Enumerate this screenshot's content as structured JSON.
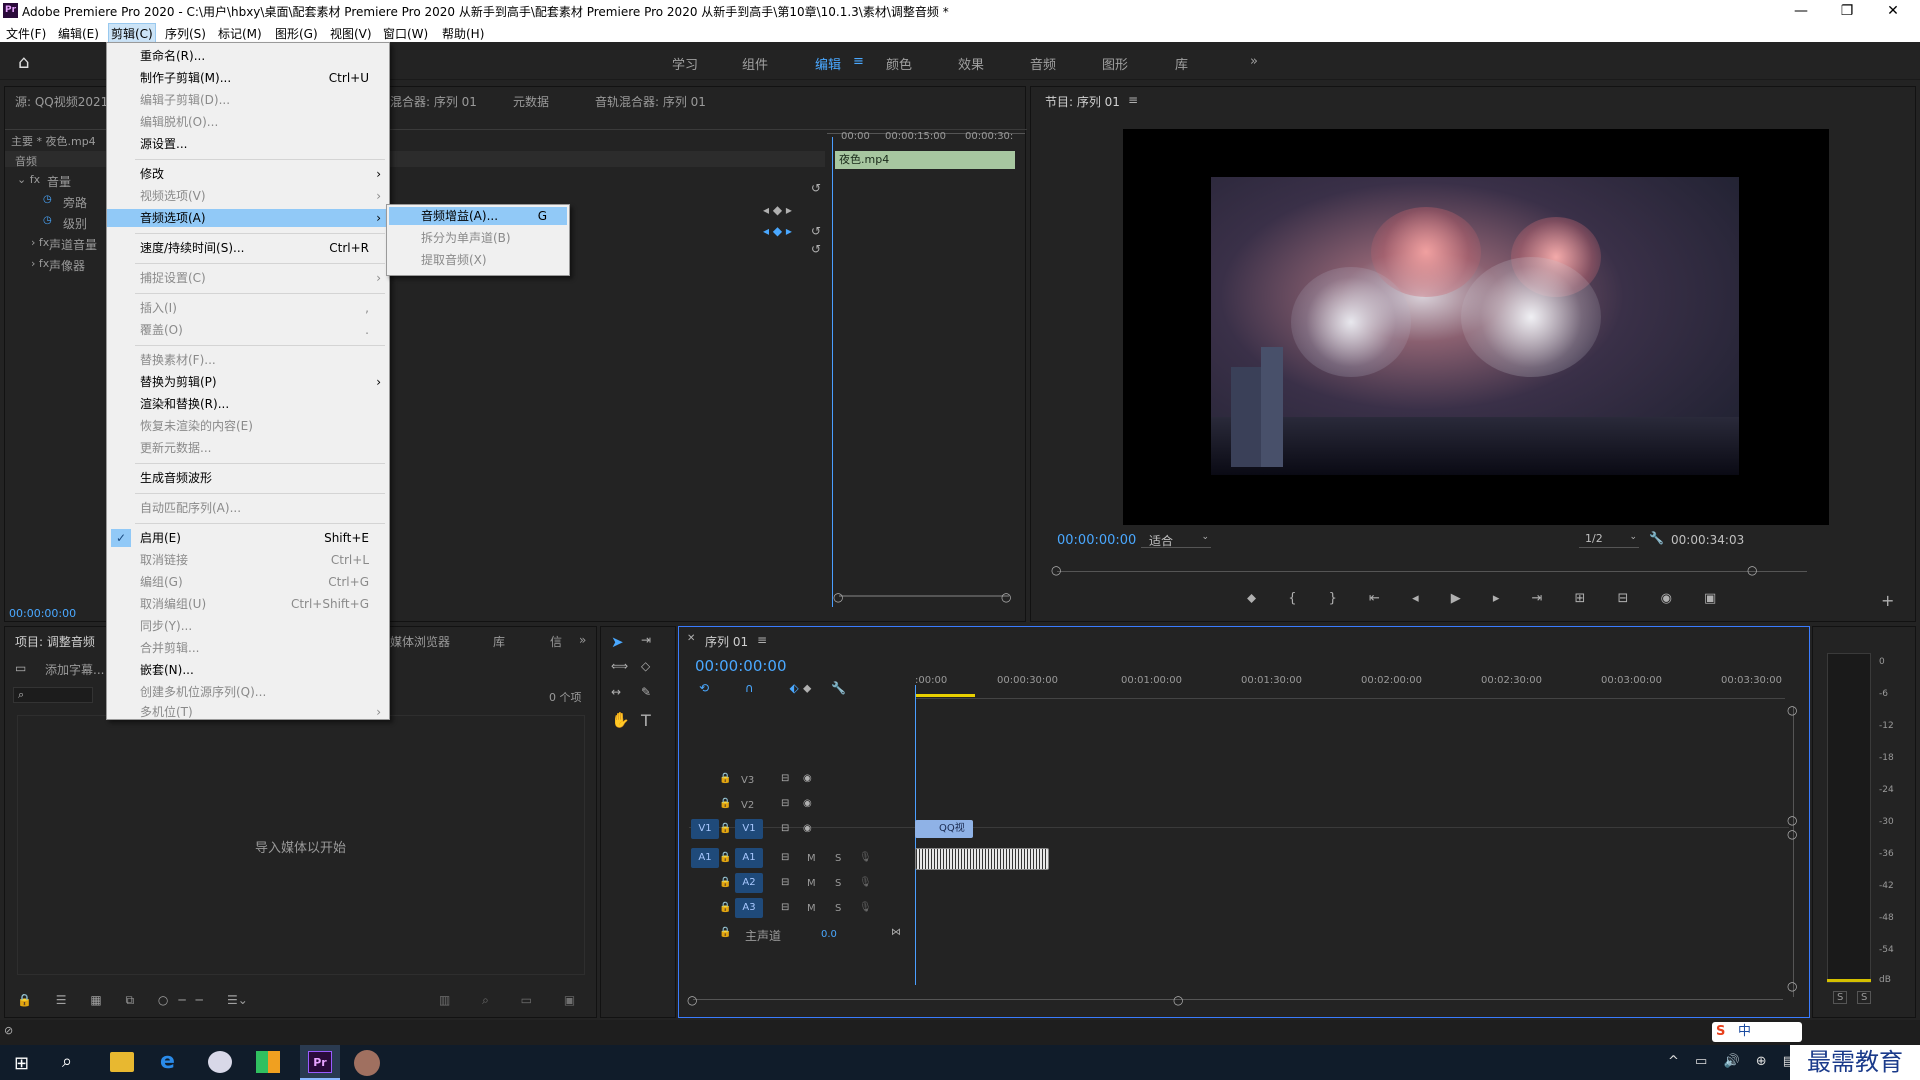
{
  "window": {
    "title": "Adobe Premiere Pro 2020 - C:\\用户\\hbxy\\桌面\\配套素材 Premiere Pro 2020 从新手到高手\\配套素材 Premiere Pro 2020 从新手到高手\\第10章\\10.1.3\\素材\\调整音频 *",
    "logo": "Pr"
  },
  "menubar": [
    "文件(F)",
    "编辑(E)",
    "剪辑(C)",
    "序列(S)",
    "标记(M)",
    "图形(G)",
    "视图(V)",
    "窗口(W)",
    "帮助(H)"
  ],
  "workspaces": [
    "学习",
    "组件",
    "编辑",
    "颜色",
    "效果",
    "音频",
    "图形",
    "库"
  ],
  "source_panel": {
    "title": "源: QQ视频2021",
    "tabs": [
      "混合器: 序列 01",
      "元数据",
      "音轨混合器: 序列 01"
    ],
    "master": "主要 * 夜色.mp4",
    "section": "音频",
    "fx_volume": "音量",
    "bypass": "旁路",
    "level": "级别",
    "channel_volume": "声道音量",
    "panner": "声像器",
    "clip_name": "夜色.mp4",
    "times": [
      "00:00",
      "00:00:15:00",
      "00:00:30:"
    ],
    "timecode": "00:00:00:00"
  },
  "clip_menu": {
    "items": [
      {
        "label": "重命名(R)...",
        "key": "",
        "enabled": true
      },
      {
        "label": "制作子剪辑(M)...",
        "key": "Ctrl+U",
        "enabled": true
      },
      {
        "label": "编辑子剪辑(D)...",
        "key": "",
        "enabled": false
      },
      {
        "label": "编辑脱机(O)...",
        "key": "",
        "enabled": false
      },
      {
        "label": "源设置...",
        "key": "",
        "enabled": true
      },
      {
        "label": "修改",
        "key": "",
        "enabled": true,
        "sub": true
      },
      {
        "label": "视频选项(V)",
        "key": "",
        "enabled": false,
        "sub": true
      },
      {
        "label": "音频选项(A)",
        "key": "",
        "enabled": true,
        "sub": true,
        "highlight": true
      },
      {
        "label": "速度/持续时间(S)...",
        "key": "Ctrl+R",
        "enabled": true
      },
      {
        "label": "捕捉设置(C)",
        "key": "",
        "enabled": false,
        "sub": true
      },
      {
        "label": "插入(I)",
        "key": ",",
        "enabled": false
      },
      {
        "label": "覆盖(O)",
        "key": ".",
        "enabled": false
      },
      {
        "label": "替换素材(F)...",
        "key": "",
        "enabled": false
      },
      {
        "label": "替换为剪辑(P)",
        "key": "",
        "enabled": true,
        "sub": true
      },
      {
        "label": "渲染和替换(R)...",
        "key": "",
        "enabled": true
      },
      {
        "label": "恢复未渲染的内容(E)",
        "key": "",
        "enabled": false
      },
      {
        "label": "更新元数据...",
        "key": "",
        "enabled": false
      },
      {
        "label": "生成音频波形",
        "key": "",
        "enabled": true
      },
      {
        "label": "自动匹配序列(A)...",
        "key": "",
        "enabled": false
      },
      {
        "label": "启用(E)",
        "key": "Shift+E",
        "enabled": true,
        "checked": true
      },
      {
        "label": "取消链接",
        "key": "Ctrl+L",
        "enabled": false
      },
      {
        "label": "编组(G)",
        "key": "Ctrl+G",
        "enabled": false
      },
      {
        "label": "取消编组(U)",
        "key": "Ctrl+Shift+G",
        "enabled": false
      },
      {
        "label": "同步(Y)...",
        "key": "",
        "enabled": false
      },
      {
        "label": "合并剪辑...",
        "key": "",
        "enabled": false
      },
      {
        "label": "嵌套(N)...",
        "key": "",
        "enabled": true
      },
      {
        "label": "创建多机位源序列(Q)...",
        "key": "",
        "enabled": false
      },
      {
        "label": "多机位(T)",
        "key": "",
        "enabled": false,
        "sub": true
      }
    ]
  },
  "audio_submenu": [
    {
      "label": "音频增益(A)...",
      "key": "G",
      "enabled": true,
      "highlight": true
    },
    {
      "label": "拆分为单声道(B)",
      "key": "",
      "enabled": false
    },
    {
      "label": "提取音频(X)",
      "key": "",
      "enabled": false
    }
  ],
  "program_panel": {
    "title": "节目: 序列 01",
    "timecode": "00:00:00:00",
    "fit": "适合",
    "resolution": "1/2",
    "duration": "00:00:34:03"
  },
  "project_panel": {
    "title": "项目: 调整音频",
    "tabs": [
      "媒体浏览器",
      "库"
    ],
    "add_caption": "添加字幕...",
    "count": "0 个项",
    "empty": "导入媒体以开始"
  },
  "timeline": {
    "title": "序列 01",
    "timecode": "00:00:00:00",
    "ruler": [
      ":00:00",
      "00:00:30:00",
      "00:01:00:00",
      "00:01:30:00",
      "00:02:00:00",
      "00:02:30:00",
      "00:03:00:00",
      "00:03:30:00"
    ],
    "video_tracks": [
      "V3",
      "V2",
      "V1"
    ],
    "audio_tracks": [
      "A1",
      "A2",
      "A3"
    ],
    "master": "主声道",
    "master_val": "0.0",
    "clip_label": "QQ视",
    "src_v": "V1",
    "src_a": "A1",
    "m": "M",
    "s": "S"
  },
  "meter": {
    "labels": [
      "0",
      "-6",
      "-12",
      "-18",
      "-24",
      "-30",
      "-36",
      "-42",
      "-48",
      "-54",
      "dB"
    ],
    "solo": [
      "S",
      "S"
    ]
  },
  "ime": {
    "label": "中"
  },
  "watermark": "最需教育"
}
